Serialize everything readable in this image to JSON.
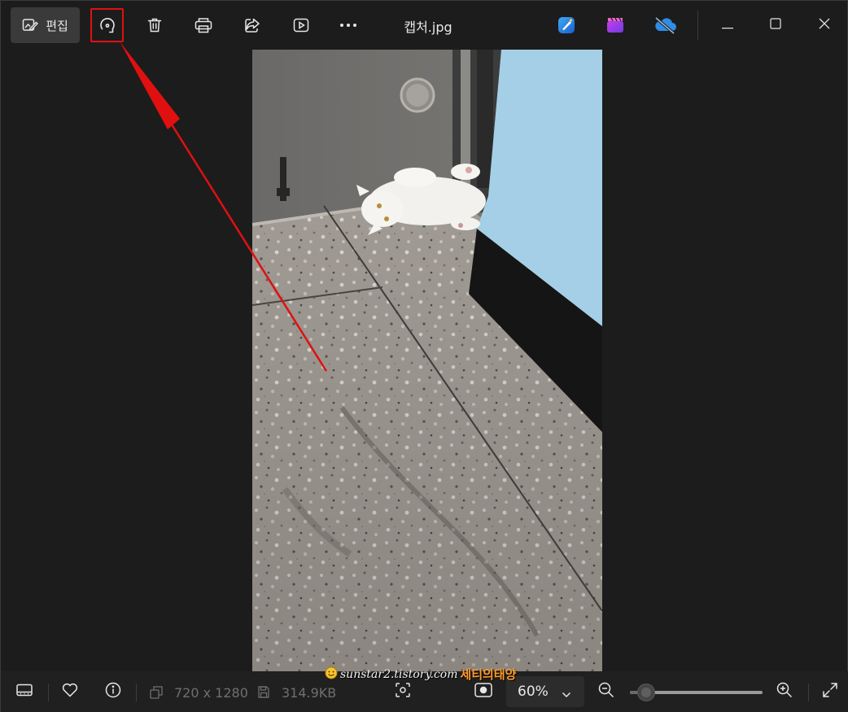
{
  "toolbar": {
    "edit_label": "편집",
    "file_title": "캡처.jpg"
  },
  "photo": {
    "subject": "white cat lying on terrazzo floor beside blue wall"
  },
  "info": {
    "dimensions": "720 x 1280",
    "file_size": "314.9KB"
  },
  "zoom": {
    "value_label": "60%",
    "level_fraction": 0.12
  },
  "watermark": {
    "url": "sunstar2.tistory.com",
    "name": "세티의태양"
  },
  "icons": {
    "edit": "edit-image-icon",
    "rotate": "rotate-icon",
    "delete": "trash-icon",
    "print": "printer-icon",
    "share": "share-icon",
    "slideshow": "play-icon",
    "more": "more-icon",
    "designer": "designer-app-icon",
    "clipchamp": "clipchamp-icon",
    "onedrive": "onedrive-offline-icon",
    "filmstrip": "filmstrip-icon",
    "favorite": "heart-icon",
    "info": "info-icon",
    "fit": "fit-to-window-icon",
    "actual": "actual-size-icon",
    "zoom_out": "zoom-out-icon",
    "zoom_in": "zoom-in-icon",
    "fullscreen": "fullscreen-icon"
  },
  "colors": {
    "window_bg": "#1c1c1c",
    "annotation_red": "#e01010",
    "wall_blue": "#a5cfe6",
    "watermark_orange": "#ff9a2a"
  }
}
